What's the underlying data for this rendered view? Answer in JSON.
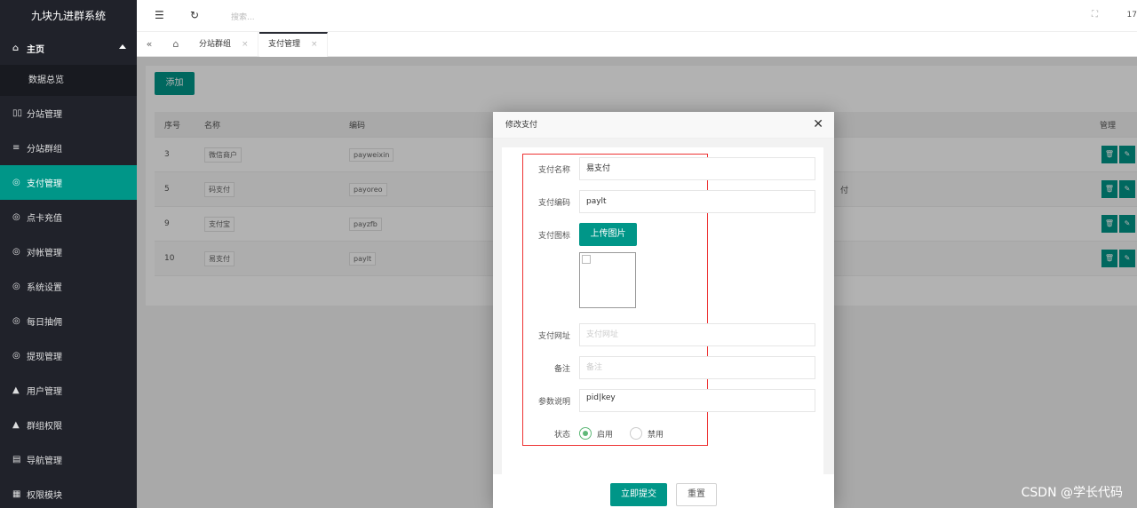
{
  "app_title": "九块九进群系统",
  "sidebar": {
    "home": "主页",
    "home_sub": "数据总览",
    "items": [
      {
        "icon": "▯▯",
        "label": "分站管理"
      },
      {
        "icon": "≡",
        "label": "分站群组"
      },
      {
        "icon": "◎",
        "label": "支付管理"
      },
      {
        "icon": "◎",
        "label": "点卡充值"
      },
      {
        "icon": "◎",
        "label": "对帐管理"
      },
      {
        "icon": "◎",
        "label": "系统设置"
      },
      {
        "icon": "◎",
        "label": "每日抽佣"
      },
      {
        "icon": "◎",
        "label": "提现管理"
      },
      {
        "icon": "▲",
        "label": "用户管理"
      },
      {
        "icon": "▲",
        "label": "群组权限"
      },
      {
        "icon": "▤",
        "label": "导航管理"
      },
      {
        "icon": "▦",
        "label": "权限模块"
      }
    ],
    "active_index": 2
  },
  "header": {
    "search_placeholder": "搜索...",
    "right_text": "17"
  },
  "tabs": [
    {
      "label": "分站群组"
    },
    {
      "label": "支付管理"
    }
  ],
  "main": {
    "add_label": "添加",
    "columns": {
      "index": "序号",
      "name": "名称",
      "code": "编码",
      "manage": "管理"
    },
    "rows": [
      {
        "index": "3",
        "name": "微信商户",
        "code": "payweixin",
        "extra": ""
      },
      {
        "index": "5",
        "name": "码支付",
        "code": "payoreo",
        "extra": "付"
      },
      {
        "index": "9",
        "name": "支付宝",
        "code": "payzfb",
        "extra": ""
      },
      {
        "index": "10",
        "name": "易支付",
        "code": "paylt",
        "extra": ""
      }
    ]
  },
  "modal": {
    "title": "修改支付",
    "fields": {
      "name_label": "支付名称",
      "name_value": "易支付",
      "code_label": "支付编码",
      "code_value": "paylt",
      "icon_label": "支付图标",
      "upload_label": "上传图片",
      "url_label": "支付网址",
      "url_placeholder": "支付网址",
      "note_label": "备注",
      "note_placeholder": "备注",
      "params_label": "参数说明",
      "params_value": "pid|key",
      "status_label": "状态",
      "status_on": "启用",
      "status_off": "禁用"
    },
    "submit_label": "立即提交",
    "reset_label": "重置"
  },
  "watermark": "CSDN @学长代码",
  "colors": {
    "primary": "#009688",
    "sidebar": "#20222a",
    "highlight_box": "#ee3333"
  }
}
